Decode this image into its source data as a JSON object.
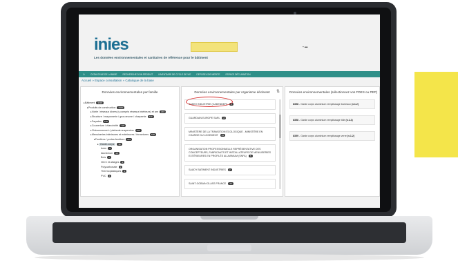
{
  "colors": {
    "accent_yellow": "#f4e54a",
    "nav_teal": "#2f8f88",
    "brand_blue": "#1d6f93",
    "highlight_red": "#d62d2d"
  },
  "site": {
    "logo_text": "inies",
    "tagline": "Les données environnementales et sanitaires de référence pour le bâtiment"
  },
  "nav": {
    "home_icon": "home-icon",
    "items": [
      "CATALOGUE DE LA BASE",
      "RECHERCHE D'UN PRODUIT",
      "INVENTAIRE DE CYCLE DE VIE",
      "DEPOSE A'DE MERITE",
      "ESPACE DÉCLARATION"
    ]
  },
  "breadcrumb": {
    "home": "Accueil",
    "sep1": "»",
    "level1": "Espace consultation",
    "sep2": "»",
    "level2": "Catalogue de la base"
  },
  "families_panel": {
    "title": "Données environnementales par famille",
    "tree": [
      {
        "label": "Bâtiment",
        "count": "3333",
        "level": 0
      },
      {
        "label": "Produits de construction",
        "count": "2900",
        "level": 1
      },
      {
        "label": "Voirie / réseaux divers (y compris réseaux intérieurs) et aménagements extérieurs de la parcelle",
        "count": "210",
        "level": 2
      },
      {
        "label": "Structure / maçonnerie / gros œuvre / charpente",
        "count": "440",
        "level": 2
      },
      {
        "label": "Façades",
        "count": "110",
        "level": 2
      },
      {
        "label": "Couverture / étanchéité",
        "count": "120",
        "level": 2
      },
      {
        "label": "Cloisonnement / plafonds-suspendus",
        "count": "150",
        "level": 2
      },
      {
        "label": "Menuiseries intérieures et extérieures / fermetures",
        "count": "620",
        "level": 2
      },
      {
        "label": "Fenêtres / portes-fenêtres",
        "count": "210",
        "level": 3
      },
      {
        "label": "Garde-corps",
        "count": "38",
        "level": 4,
        "selected": true
      },
      {
        "label": "Acier",
        "count": "2",
        "level": 5
      },
      {
        "label": "Aluminium",
        "count": "18",
        "level": 5
      },
      {
        "label": "Bois",
        "count": "2",
        "level": 5
      },
      {
        "label": "Verre et alliages",
        "count": "4",
        "level": 5
      },
      {
        "label": "Polycarbonate",
        "count": "2",
        "level": 5
      },
      {
        "label": "Thermoplastiques",
        "count": "3",
        "level": 5
      },
      {
        "label": "PVC",
        "count": "4",
        "level": 5
      }
    ]
  },
  "orgs_panel": {
    "title": "Données environnementales par organisme déclarant",
    "sort_icon": "sort-icon",
    "items": [
      {
        "label": "SADEV INDUSTRIE (CADENDER)",
        "count": "3"
      },
      {
        "label": "GUARDIAN EUROPE SARL",
        "count": "2"
      },
      {
        "label": "MINISTÈRE DE LA TRANSITION ÉCOLOGIQUE - MINISTÈRE EN CHARGE DU LOGEMENT",
        "count": "45"
      },
      {
        "label": "ORGANISATION PROFESSIONNELLE REPRÉSENTATIVE DES CONCEPTEURS, FABRICANTS ET INSTALLATEURS DE MENUISERIES EXTÉRIEURES EN PROFILÉS ALUMINIUM (SNFA)",
        "count": "5"
      },
      {
        "label": "SAUDY BATIMENT INDUSTRIES",
        "count": "2"
      },
      {
        "label": "SAINT-GOBAIN GLASS FRANCE",
        "count": "20"
      }
    ]
  },
  "fdes_panel": {
    "title": "Données environnementales (sélectionnez vos FDES ou PEP)",
    "items": [
      {
        "id": "8358",
        "label": "Garde corps aluminium remplissage barreaux",
        "version": "(v.1.2)"
      },
      {
        "id": "8358",
        "label": "Garde corps aluminium remplissage tôle",
        "version": "(v.1.2)"
      },
      {
        "id": "8359",
        "label": "Garde corps aluminium remplissage verre",
        "version": "(v.1.2)"
      }
    ]
  }
}
